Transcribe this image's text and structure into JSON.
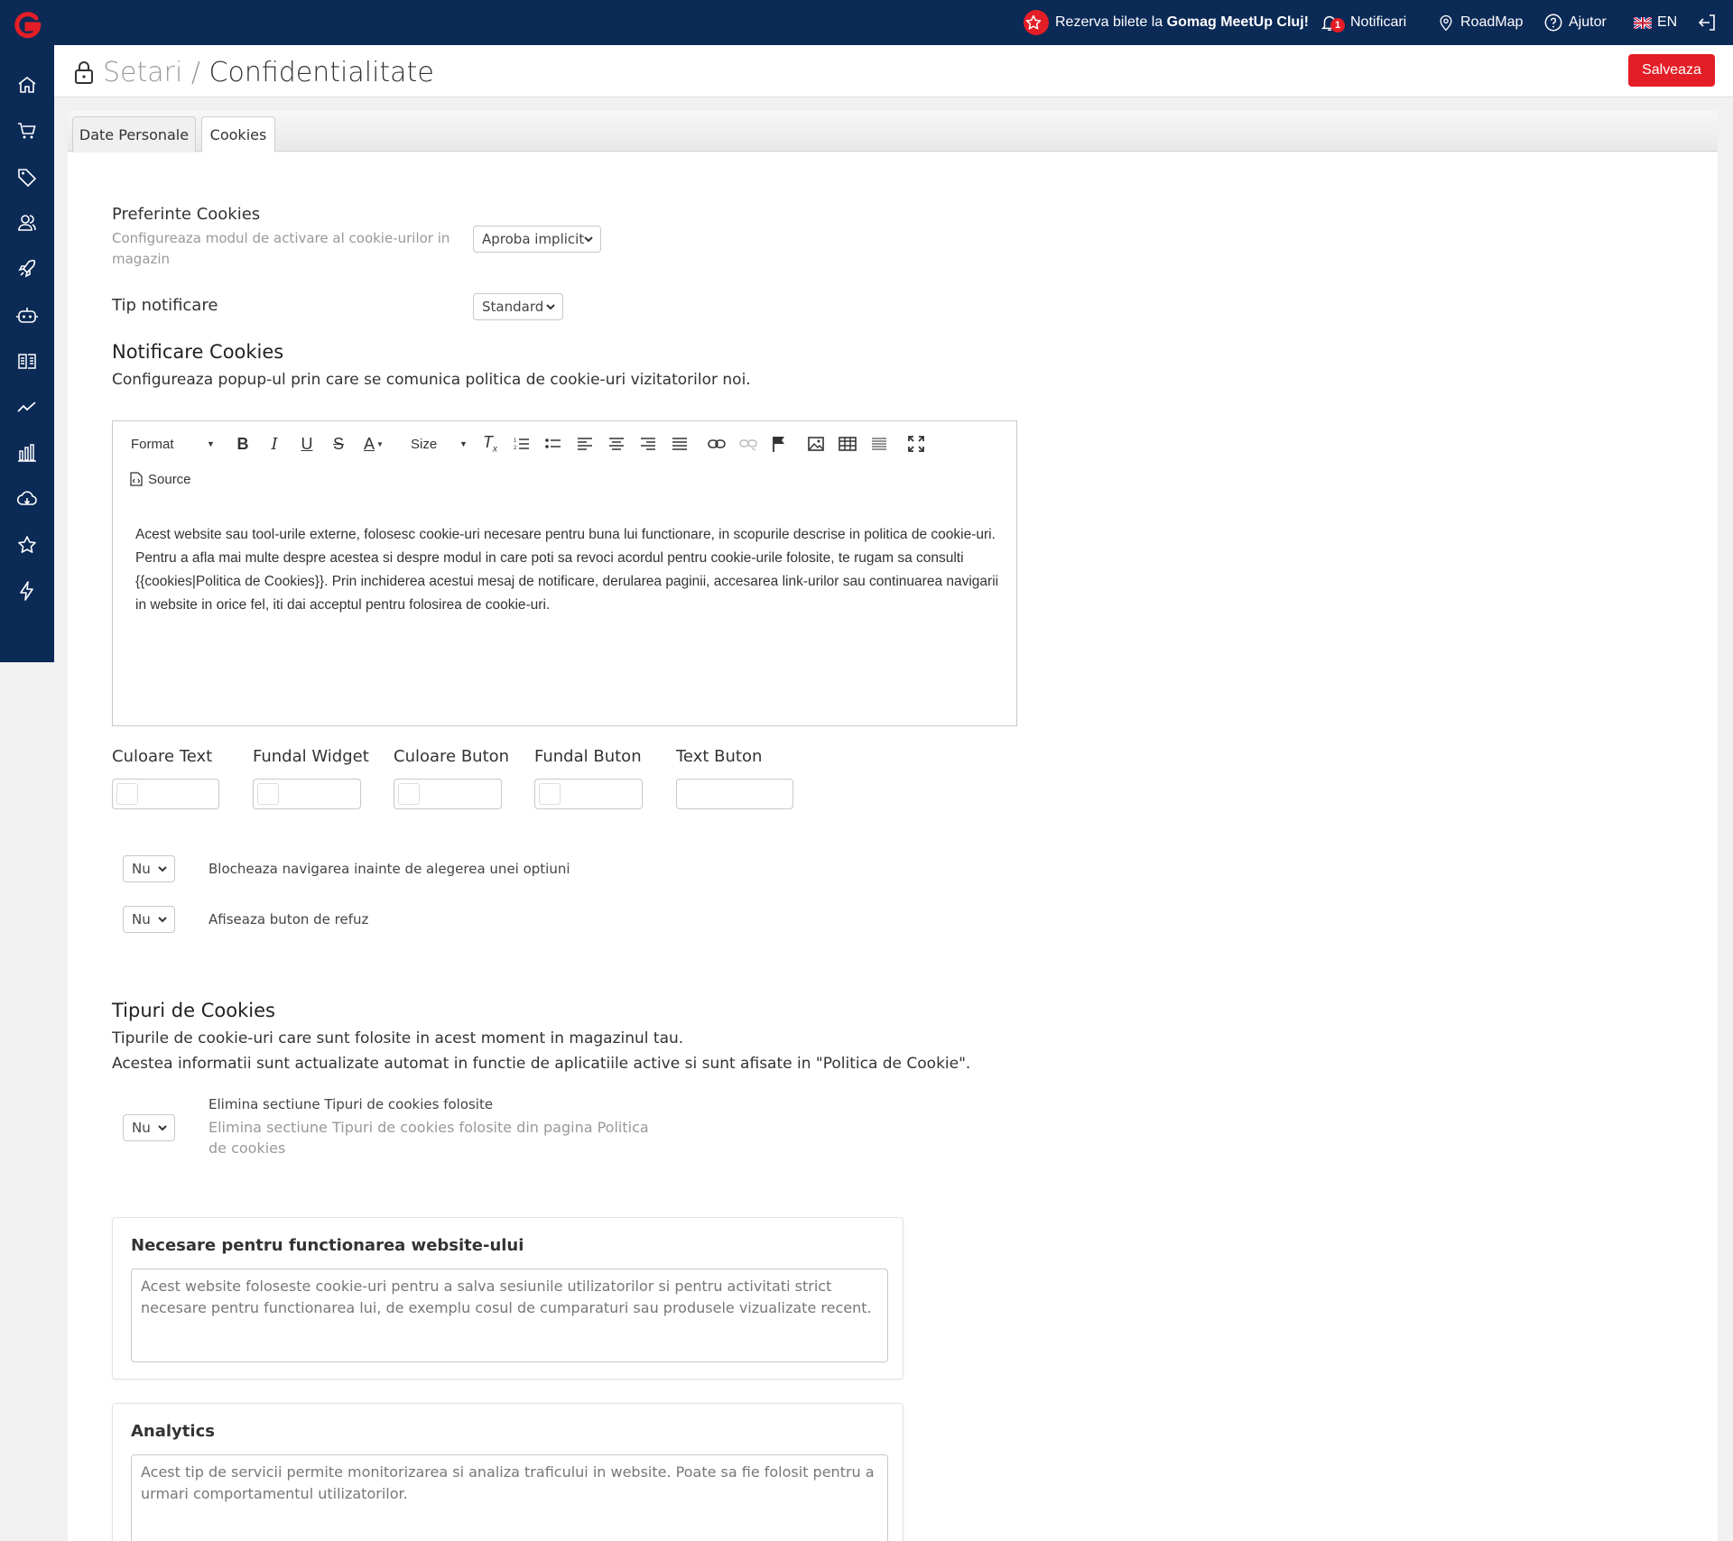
{
  "topbar": {
    "promo_prefix": "Rezerva bilete la ",
    "promo_bold": "Gomag MeetUp Cluj!",
    "notifications_label": "Notificari",
    "notifications_count": "1",
    "roadmap_label": "RoadMap",
    "help_label": "Ajutor",
    "language": "EN"
  },
  "sidebar": {
    "items": [
      "home-icon",
      "cart-icon",
      "tag-icon",
      "users-icon",
      "rocket-icon",
      "robot-icon",
      "book-icon",
      "trend-icon",
      "bar-chart-icon",
      "cloud-icon",
      "star-icon",
      "bolt-icon"
    ]
  },
  "header": {
    "breadcrumb_parent": "Setari",
    "breadcrumb_sep": "/",
    "breadcrumb_current": "Confidentialitate",
    "save_label": "Salveaza"
  },
  "tabs": [
    {
      "label": "Date Personale",
      "active": false
    },
    {
      "label": "Cookies",
      "active": true
    }
  ],
  "prefs": {
    "label": "Preferinte Cookies",
    "hint": "Configureaza modul de activare al cookie-urilor in magazin",
    "value": "Aproba implicit"
  },
  "notif_type": {
    "label": "Tip notificare",
    "value": "Standard"
  },
  "notif_section": {
    "title": "Notificare Cookies",
    "desc": "Configureaza popup-ul prin care se comunica politica de cookie-uri vizitatorilor noi."
  },
  "editor": {
    "format_label": "Format",
    "size_label": "Size",
    "source_label": "Source",
    "body": "Acest website sau tool-urile externe, folosesc cookie-uri necesare pentru buna lui functionare, in scopurile descrise in politica de cookie-uri. Pentru a afla mai multe despre acestea si despre modul in care poti sa revoci acordul pentru cookie-urile folosite, te rugam sa consulti {{cookies|Politica de Cookies}}. Prin inchiderea acestui mesaj de notificare, derularea paginii, accesarea link-urilor sau continuarea navigarii in website in orice fel, iti dai acceptul pentru folosirea de cookie-uri."
  },
  "colors": {
    "text_color_label": "Culoare Text",
    "widget_bg_label": "Fundal Widget",
    "button_color_label": "Culoare Buton",
    "button_bg_label": "Fundal Buton",
    "button_text_label": "Text Buton"
  },
  "toggles": {
    "block_nav_value": "Nu",
    "block_nav_label": "Blocheaza navigarea inainte de alegerea unei optiuni",
    "refuse_btn_value": "Nu",
    "refuse_btn_label": "Afiseaza buton de refuz"
  },
  "types_section": {
    "title": "Tipuri de Cookies",
    "desc_line1": "Tipurile de cookie-uri care sunt folosite in acest moment in magazinul tau.",
    "desc_line2": "Acestea informatii sunt actualizate automat in functie de aplicatiile active si sunt afisate in \"Politica de Cookie\".",
    "remove_value": "Nu",
    "remove_label": "Elimina sectiune Tipuri de cookies folosite",
    "remove_hint": "Elimina sectiune Tipuri de cookies folosite din pagina Politica de cookies"
  },
  "cards": [
    {
      "title": "Necesare pentru functionarea website-ului",
      "text": "Acest website foloseste cookie-uri pentru a salva sesiunile utilizatorilor si pentru activitati strict necesare pentru functionarea lui, de exemplu cosul de cumparaturi sau produsele vizualizate recent."
    },
    {
      "title": "Analytics",
      "text": "Acest tip de servicii permite monitorizarea si analiza traficului in website. Poate sa fie folosit pentru a urmari comportamentul utilizatorilor."
    }
  ],
  "theme": {
    "navy": "#0b2a56",
    "accent": "#e41e26"
  }
}
